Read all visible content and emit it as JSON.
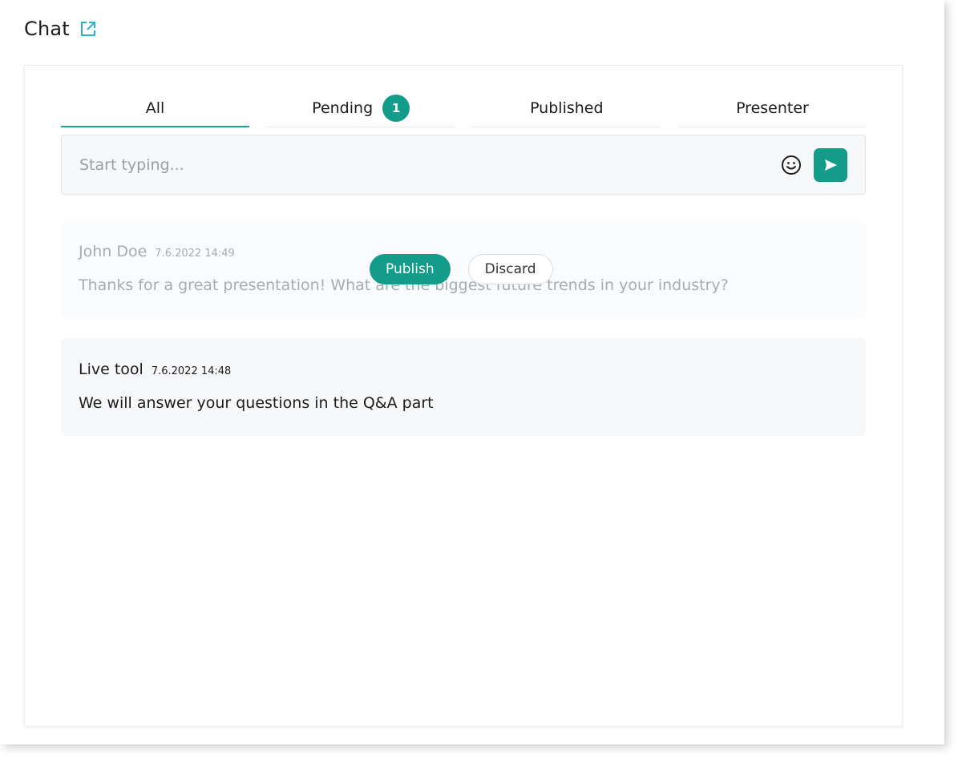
{
  "header": {
    "title": "Chat"
  },
  "tabs": [
    {
      "label": "All",
      "active": true
    },
    {
      "label": "Pending",
      "badge": "1"
    },
    {
      "label": "Published"
    },
    {
      "label": "Presenter"
    }
  ],
  "composer": {
    "placeholder": "Start typing...",
    "emoji_icon": "smiley-icon",
    "send_icon": "send-arrow-icon"
  },
  "messages": [
    {
      "author": "John Doe",
      "time": "7.6.2022 14:49",
      "text": "Thanks for a great presentation! What are the biggest future trends in your industry?",
      "status": "pending",
      "actions": {
        "publish_label": "Publish",
        "discard_label": "Discard"
      }
    },
    {
      "author": "Live tool",
      "time": "7.6.2022 14:48",
      "text": "We will answer your questions in the Q&A part",
      "status": "published"
    }
  ],
  "colors": {
    "accent": "#149c8a",
    "external_link_icon": "#2ab3c7"
  }
}
